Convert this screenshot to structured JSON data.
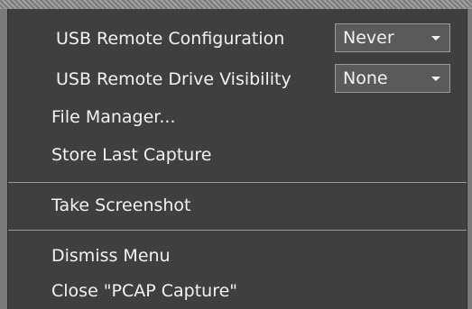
{
  "menu": {
    "usb_remote_configuration": {
      "label": "USB Remote Configuration",
      "selected": "Never"
    },
    "usb_remote_drive_visibility": {
      "label": "USB Remote Drive Visibility",
      "selected": "None"
    },
    "file_manager": "File Manager...",
    "store_last_capture": "Store Last Capture",
    "take_screenshot": "Take Screenshot",
    "dismiss_menu": "Dismiss Menu",
    "close_capture": "Close \"PCAP Capture\""
  },
  "icons": {
    "dropdown": "chevron-down-icon"
  },
  "colors": {
    "menu_background": "#3f3f3f",
    "text": "#f2f2f2",
    "select_background": "#5a5a5a",
    "separator": "#9a9a9a"
  }
}
